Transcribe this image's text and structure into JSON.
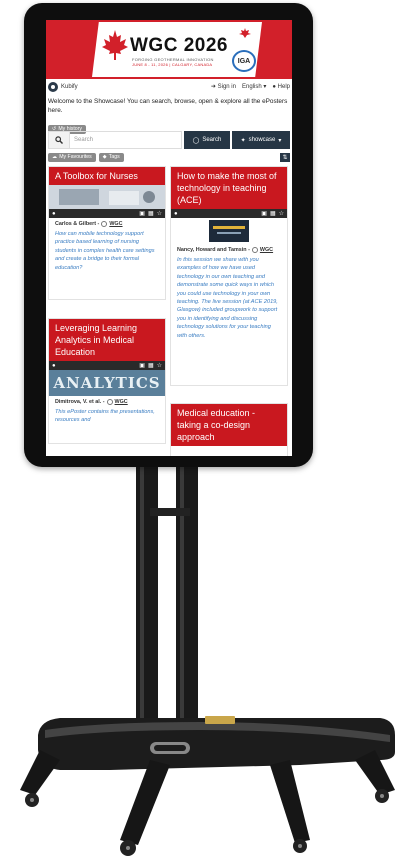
{
  "banner": {
    "title": "WGC 2026",
    "subtitle1": "FORGING GEOTHERMAL INNOVATION",
    "subtitle2": "JUNE 8 - 11, 2026 | CALGARY, CANADA",
    "iga": "IGA",
    "brand_color": "#d2202a"
  },
  "topbar": {
    "brand": "Kubify",
    "sign_in": "Sign in",
    "language": "English",
    "help": "Help"
  },
  "welcome": "Welcome to the Showcase! You can search, browse, open & explore all the ePosters here.",
  "history_label": "My history",
  "search": {
    "placeholder": "Search",
    "button": "Search",
    "showcase": "showcase"
  },
  "filters": {
    "favourites": "My Favourites",
    "tags": "Tags"
  },
  "posters": [
    {
      "title": "A Toolbox for Nurses",
      "authors": "Carlos & Gilbert - ",
      "org": "WGC",
      "description": "How can mobile technology support practice based learning of nursing students in complex health care settings and create a bridge to their formal education?"
    },
    {
      "title": "How to make the most of technology in teaching (ACE)",
      "authors": "Nancy, Howard and Tamsin - ",
      "org": "WGC",
      "description": "In this session we share with you examples of how we have used technology in our own teaching and demonstrate some quick ways in which you could use technology in your own teaching. The live session (at ACE 2019, Glasgow) included groupwork to support you in identifying and discussing technology solutions for your teaching with others."
    },
    {
      "title": "Leveraging Learning Analytics in Medical Education",
      "authors": "Dimitrova, V. et al. - ",
      "org": "WGC",
      "thumb_text": "ANALYTICS",
      "description": "This ePoster contains the presentations, resources and"
    },
    {
      "title": "Medical education - taking a co-design approach"
    }
  ],
  "accent": "#263645",
  "card_red": "#c9181f"
}
